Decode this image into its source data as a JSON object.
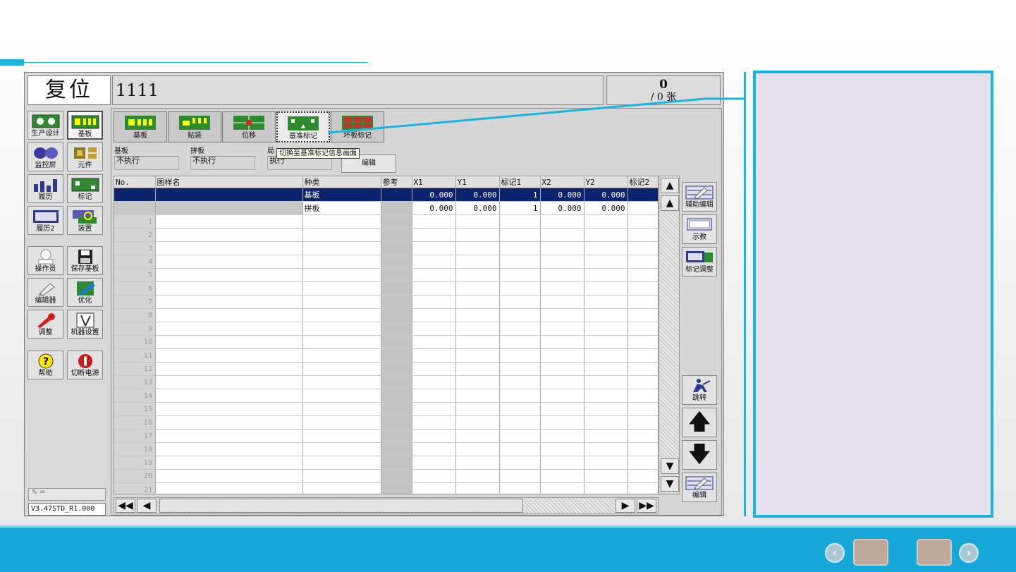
{
  "header": {
    "title": "复位",
    "program_name": "1111",
    "count_value": "0",
    "count_unit": "/ 0 张"
  },
  "sidebar": {
    "buttons": [
      {
        "label": "生产设计",
        "icon": "production-design-icon"
      },
      {
        "label": "基板",
        "icon": "board-icon"
      },
      {
        "label": "监控屏",
        "icon": "monitor-icon"
      },
      {
        "label": "元件",
        "icon": "component-icon"
      },
      {
        "label": "履历",
        "icon": "history-icon"
      },
      {
        "label": "标记",
        "icon": "mark-icon"
      },
      {
        "label": "履历2",
        "icon": "history2-icon"
      },
      {
        "label": "装置",
        "icon": "device-icon"
      },
      {
        "label": "操作员",
        "icon": "operator-icon"
      },
      {
        "label": "保存基板",
        "icon": "save-board-icon"
      },
      {
        "label": "编辑器",
        "icon": "editor-icon"
      },
      {
        "label": "优化",
        "icon": "optimize-icon"
      },
      {
        "label": "调整",
        "icon": "adjust-icon"
      },
      {
        "label": "机器设置",
        "icon": "machine-settings-icon"
      },
      {
        "label": "帮助",
        "icon": "help-icon"
      },
      {
        "label": "切断电源",
        "icon": "power-off-icon"
      }
    ],
    "version": "V3.47STD_R1.000"
  },
  "tabs": [
    "基板",
    "贴装",
    "位移",
    "基准标记",
    "坏板标记"
  ],
  "tooltip": "切换至基准标记信息画面",
  "info": {
    "board_label": "基板",
    "board_value": "不执行",
    "panel_label": "拼板",
    "panel_value": "不执行",
    "local_label": "局",
    "local_value": "执行",
    "edit_button": "编辑"
  },
  "table": {
    "columns": [
      "No.",
      "图样名",
      "种类",
      "参考",
      "X1",
      "Y1",
      "标记1",
      "X2",
      "Y2",
      "标记2"
    ],
    "data_rows": [
      {
        "no": "",
        "name": "",
        "kind": "基板",
        "ref": "",
        "x1": "0.000",
        "y1": "0.000",
        "mark1": "1",
        "x2": "0.000",
        "y2": "0.000",
        "mark2": ""
      },
      {
        "no": "",
        "name": "",
        "kind": "拼板",
        "ref": "",
        "x1": "0.000",
        "y1": "0.000",
        "mark1": "1",
        "x2": "0.000",
        "y2": "0.000",
        "mark2": ""
      }
    ],
    "empty_row_numbers": [
      "1",
      "2",
      "3",
      "4",
      "5",
      "6",
      "7",
      "8",
      "9",
      "10",
      "11",
      "12",
      "13",
      "14",
      "15",
      "16",
      "17",
      "18",
      "19",
      "20",
      "21"
    ]
  },
  "right_buttons": {
    "aux_edit": "辅助编辑",
    "teach": "示教",
    "mark_adjust": "标记调整",
    "jump": "跳转",
    "edit": "编辑"
  },
  "colors": {
    "accent": "#19b4e0",
    "selected_row": "#0c246b",
    "callout_fill": "#e4e0ee"
  }
}
